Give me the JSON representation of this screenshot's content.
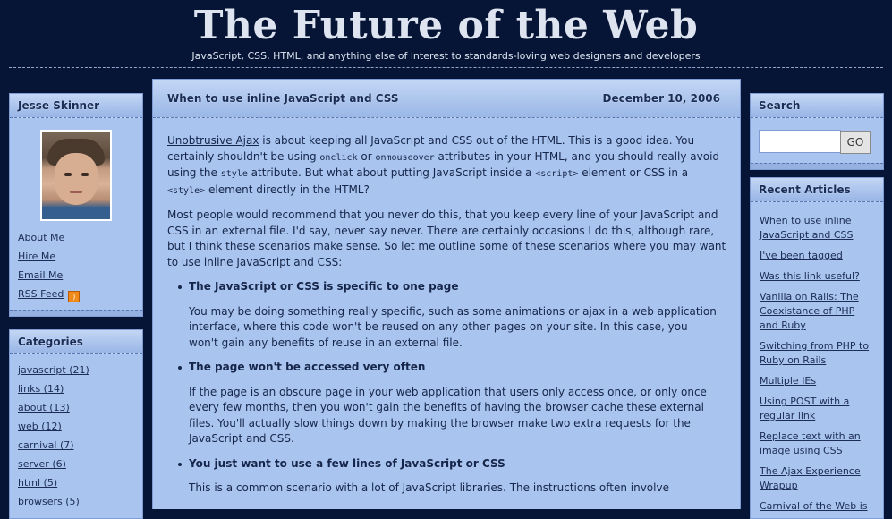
{
  "header": {
    "title": "The Future of the Web",
    "tagline": "JavaScript, CSS, HTML, and anything else of interest to standards-loving web designers and developers"
  },
  "author_box": {
    "heading": "Jesse Skinner",
    "links": [
      "About Me",
      "Hire Me",
      "Email Me",
      "RSS Feed"
    ]
  },
  "categories_box": {
    "heading": "Categories",
    "items": [
      "javascript (21)",
      "links (14)",
      "about (13)",
      "web (12)",
      "carnival (7)",
      "server (6)",
      "html (5)",
      "browsers (5)"
    ]
  },
  "post": {
    "title": "When to use inline JavaScript and CSS",
    "date": "December 10, 2006",
    "p1": {
      "link": "Unobtrusive Ajax",
      "t1": " is about keeping all JavaScript and CSS out of the HTML. This is a good idea. You certainly shouldn't be using ",
      "c1": "onclick",
      "t2": " or ",
      "c2": "onmouseover",
      "t3": " attributes in your HTML, and you should really avoid using the ",
      "c3": "style",
      "t4": " attribute. But what about putting JavaScript inside a ",
      "c4": "<script>",
      "t5": " element or CSS in a ",
      "c5": "<style>",
      "t6": " element directly in the HTML?"
    },
    "p2": "Most people would recommend that you never do this, that you keep every line of your JavaScript and CSS in an external file. I'd say, never say never. There are certainly occasions I do this, although rare, but I think these scenarios make sense. So let me outline some of these scenarios where you may want to use inline JavaScript and CSS:",
    "scenarios": [
      {
        "heading": "The JavaScript or CSS is specific to one page",
        "text": "You may be doing something really specific, such as some animations or ajax in a web application interface, where this code won't be reused on any other pages on your site. In this case, you won't gain any benefits of reuse in an external file."
      },
      {
        "heading": "The page won't be accessed very often",
        "text": "If the page is an obscure page in your web application that users only access once, or only once every few months, then you won't gain the benefits of having the browser cache these external files. You'll actually slow things down by making the browser make two extra requests for the JavaScript and CSS."
      },
      {
        "heading": "You just want to use a few lines of JavaScript or CSS",
        "text": "This is a common scenario with a lot of JavaScript libraries. The instructions often involve"
      }
    ]
  },
  "search_box": {
    "heading": "Search",
    "input_value": "",
    "button_label": "GO"
  },
  "recent_box": {
    "heading": "Recent Articles",
    "items": [
      "When to use inline JavaScript and CSS",
      "I've been tagged",
      "Was this link useful?",
      "Vanilla on Rails: The Coexistance of PHP and Ruby",
      "Switching from PHP to Ruby on Rails",
      "Multiple IEs",
      "Using POST with a regular link",
      "Replace text with an image using CSS",
      "The Ajax Experience Wrapup",
      "Carnival of the Web is"
    ]
  },
  "icons": {
    "rss": "rss-feed-icon"
  },
  "colors": {
    "background": "#061435",
    "panel": "#a9c4ee",
    "panel_header": "#c3d6f5",
    "text": "#16264a",
    "rss": "#f28a1a"
  }
}
